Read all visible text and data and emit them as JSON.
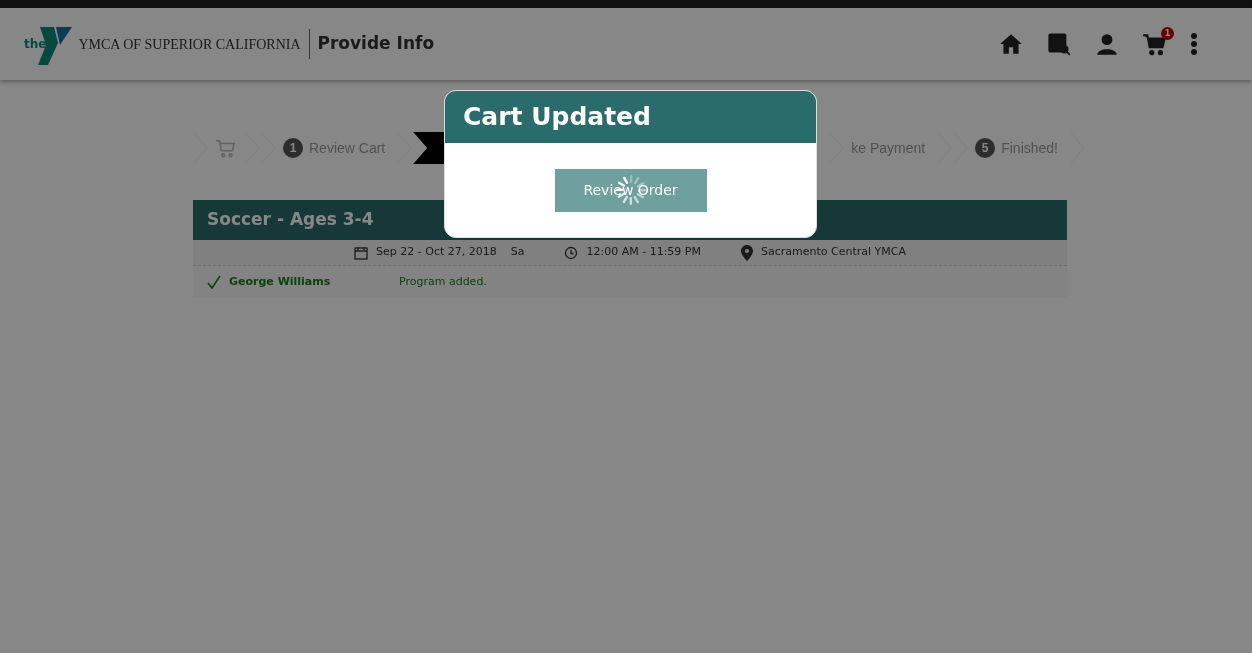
{
  "header": {
    "org_name": "YMCA OF SUPERIOR CALIFORNIA",
    "page_title": "Provide Info",
    "logo_text": "the",
    "cart_count": "1"
  },
  "steps": [
    {
      "kind": "cart",
      "selected": false
    },
    {
      "kind": "numbered",
      "number": "1",
      "label": "Review Cart",
      "selected": false
    },
    {
      "kind": "hidden",
      "selected": true
    },
    {
      "kind": "numbered",
      "label": "ke Payment",
      "selected": false
    },
    {
      "kind": "numbered",
      "number": "5",
      "label": "Finished!",
      "selected": false
    }
  ],
  "program": {
    "title": "Soccer - Ages 3-4",
    "dates": "Sep 22 - Oct 27, 2018",
    "days": "Sa",
    "time": "12:00 AM - 11:59 PM",
    "location": "Sacramento Central YMCA",
    "participants": [
      {
        "name": "George Williams",
        "status": "Program added.",
        "added": true
      }
    ]
  },
  "modal": {
    "title": "Cart Updated",
    "button": "Review Order",
    "loading": true
  }
}
